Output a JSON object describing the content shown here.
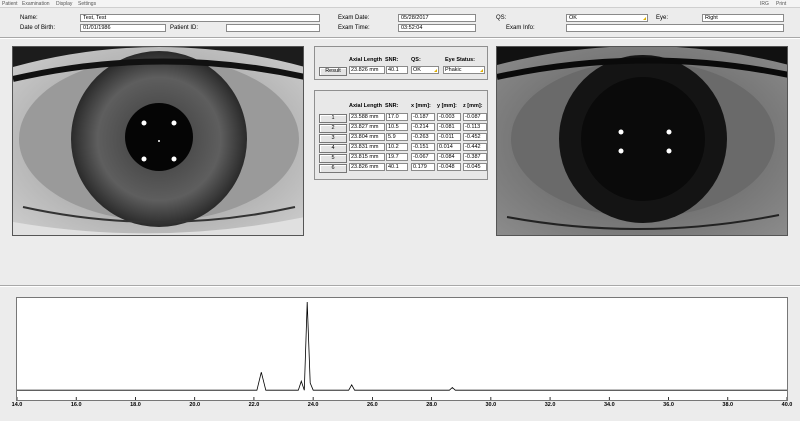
{
  "menu": {
    "items": [
      "Patient",
      "Examination",
      "Display",
      "Settings"
    ],
    "right_items": [
      "IRG",
      "Print"
    ]
  },
  "patient": {
    "name_label": "Name:",
    "name": "Test, Test",
    "dob_label": "Date of Birth:",
    "dob": "01/01/1986",
    "patient_id_label": "Patient ID:",
    "patient_id": ""
  },
  "exam": {
    "date_label": "Exam Date:",
    "date": "05/28/2017",
    "time_label": "Exam Time:",
    "time": "03:52:04",
    "qs_label": "QS:",
    "qs": "OK",
    "eye_label": "Eye:",
    "eye": "Right",
    "info_label": "Exam Info:",
    "info": ""
  },
  "result": {
    "button": "Result",
    "headers": [
      "Axial Length",
      "SNR:",
      "QS:",
      "Eye Status:"
    ],
    "axial_length": "23.826 mm",
    "snr": "40.1",
    "qs": "OK",
    "eye_status": "Phakic"
  },
  "measurements": {
    "headers": [
      "Axial Length",
      "SNR:",
      "x [mm]:",
      "y [mm]:",
      "z [mm]:"
    ],
    "rows": [
      {
        "n": "1",
        "al": "23.588 mm",
        "snr": "17.0",
        "x": "-0.187",
        "y": "-0.003",
        "z": "-0.087"
      },
      {
        "n": "2",
        "al": "23.827 mm",
        "snr": "10.5",
        "x": "-0.214",
        "y": "-0.081",
        "z": "-0.113"
      },
      {
        "n": "3",
        "al": "23.804 mm",
        "snr": "5.9",
        "x": "-0.263",
        "y": "-0.011",
        "z": "-0.452"
      },
      {
        "n": "4",
        "al": "23.831 mm",
        "snr": "10.2",
        "x": "-0.151",
        "y": "0.014",
        "z": "-0.442"
      },
      {
        "n": "5",
        "al": "23.815 mm",
        "snr": "19.7",
        "x": "-0.067",
        "y": "-0.084",
        "z": "-0.387"
      },
      {
        "n": "6",
        "al": "23.826 mm",
        "snr": "40.1",
        "x": "0.179",
        "y": "-0.048",
        "z": "-0.045"
      }
    ]
  },
  "chart_data": {
    "type": "line",
    "title": "",
    "xlabel": "",
    "ylabel": "",
    "xlim": [
      14.0,
      40.0
    ],
    "ylim": [
      0,
      100
    ],
    "xticks": [
      "14.0",
      "16.0",
      "18.0",
      "20.0",
      "22.0",
      "24.0",
      "26.0",
      "28.0",
      "30.0",
      "32.0",
      "34.0",
      "36.0",
      "38.0",
      "40.0"
    ],
    "grid": false,
    "color": "#000000",
    "x": [
      14.0,
      22.1,
      22.25,
      22.4,
      23.5,
      23.6,
      23.7,
      23.8,
      23.9,
      24.0,
      25.2,
      25.3,
      25.4,
      28.6,
      28.7,
      28.8,
      40.0
    ],
    "y": [
      2,
      2,
      22,
      2,
      2,
      12,
      2,
      100,
      10,
      2,
      2,
      8,
      2,
      2,
      5,
      2,
      2
    ]
  }
}
